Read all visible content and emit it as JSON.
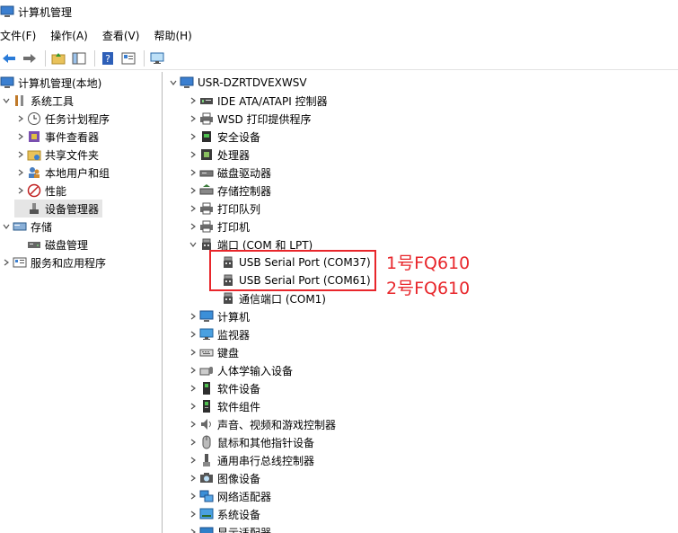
{
  "window": {
    "title": "计算机管理"
  },
  "menu": [
    "文件(F)",
    "操作(A)",
    "查看(V)",
    "帮助(H)"
  ],
  "toolbar": [
    "back-arrow-icon",
    "forward-arrow-icon",
    "up-folder-icon",
    "show-hide-tree-icon",
    "help-icon",
    "properties-icon",
    "monitor-icon"
  ],
  "left_tree": [
    {
      "label": "计算机管理(本地)",
      "icon": "computer-management-icon",
      "level": 0,
      "chev": ""
    },
    {
      "label": "系统工具",
      "icon": "system-tools-icon",
      "level": 1,
      "chev": "open"
    },
    {
      "label": "任务计划程序",
      "icon": "task-scheduler-icon",
      "level": 2,
      "chev": "closed"
    },
    {
      "label": "事件查看器",
      "icon": "event-viewer-icon",
      "level": 2,
      "chev": "closed"
    },
    {
      "label": "共享文件夹",
      "icon": "shared-folder-icon",
      "level": 2,
      "chev": "closed"
    },
    {
      "label": "本地用户和组",
      "icon": "users-icon",
      "level": 2,
      "chev": "closed"
    },
    {
      "label": "性能",
      "icon": "performance-icon",
      "level": 2,
      "chev": "closed"
    },
    {
      "label": "设备管理器",
      "icon": "device-manager-icon",
      "level": 2,
      "chev": "",
      "selected": true
    },
    {
      "label": "存储",
      "icon": "storage-icon",
      "level": 1,
      "chev": "open"
    },
    {
      "label": "磁盘管理",
      "icon": "disk-management-icon",
      "level": 2,
      "chev": ""
    },
    {
      "label": "服务和应用程序",
      "icon": "services-icon",
      "level": 1,
      "chev": "closed"
    }
  ],
  "device_tree": {
    "root": "USR-DZRTDVEXWSV",
    "items": [
      {
        "label": "IDE ATA/ATAPI 控制器",
        "icon": "ide-controller-icon",
        "level": 1,
        "chev": "closed"
      },
      {
        "label": "WSD 打印提供程序",
        "icon": "printer-icon",
        "level": 1,
        "chev": "closed"
      },
      {
        "label": "安全设备",
        "icon": "security-device-icon",
        "level": 1,
        "chev": "closed"
      },
      {
        "label": "处理器",
        "icon": "processor-icon",
        "level": 1,
        "chev": "closed"
      },
      {
        "label": "磁盘驱动器",
        "icon": "disk-drive-icon",
        "level": 1,
        "chev": "closed"
      },
      {
        "label": "存储控制器",
        "icon": "storage-controller-icon",
        "level": 1,
        "chev": "closed"
      },
      {
        "label": "打印队列",
        "icon": "printer-icon",
        "level": 1,
        "chev": "closed"
      },
      {
        "label": "打印机",
        "icon": "printer-icon",
        "level": 1,
        "chev": "closed"
      },
      {
        "label": "端口 (COM 和 LPT)",
        "icon": "port-icon",
        "level": 1,
        "chev": "open"
      },
      {
        "label": "USB Serial Port (COM37)",
        "icon": "port-icon",
        "level": 2,
        "chev": ""
      },
      {
        "label": "USB Serial Port (COM61)",
        "icon": "port-icon",
        "level": 2,
        "chev": ""
      },
      {
        "label": "通信端口 (COM1)",
        "icon": "port-icon",
        "level": 2,
        "chev": ""
      },
      {
        "label": "计算机",
        "icon": "computer-icon",
        "level": 1,
        "chev": "closed"
      },
      {
        "label": "监视器",
        "icon": "monitor-icon",
        "level": 1,
        "chev": "closed"
      },
      {
        "label": "键盘",
        "icon": "keyboard-icon",
        "level": 1,
        "chev": "closed"
      },
      {
        "label": "人体学输入设备",
        "icon": "hid-icon",
        "level": 1,
        "chev": "closed"
      },
      {
        "label": "软件设备",
        "icon": "software-device-icon",
        "level": 1,
        "chev": "closed"
      },
      {
        "label": "软件组件",
        "icon": "software-component-icon",
        "level": 1,
        "chev": "closed"
      },
      {
        "label": "声音、视频和游戏控制器",
        "icon": "sound-icon",
        "level": 1,
        "chev": "closed"
      },
      {
        "label": "鼠标和其他指针设备",
        "icon": "mouse-icon",
        "level": 1,
        "chev": "closed"
      },
      {
        "label": "通用串行总线控制器",
        "icon": "usb-icon",
        "level": 1,
        "chev": "closed"
      },
      {
        "label": "图像设备",
        "icon": "camera-icon",
        "level": 1,
        "chev": "closed"
      },
      {
        "label": "网络适配器",
        "icon": "network-icon",
        "level": 1,
        "chev": "closed"
      },
      {
        "label": "系统设备",
        "icon": "system-device-icon",
        "level": 1,
        "chev": "closed"
      },
      {
        "label": "显示适配器",
        "icon": "display-adapter-icon",
        "level": 1,
        "chev": "closed"
      }
    ]
  },
  "annotations": [
    "1号FQ610",
    "2号FQ610"
  ],
  "colors": {
    "annotation": "#e8262b",
    "selection": "#e5e5e5"
  }
}
